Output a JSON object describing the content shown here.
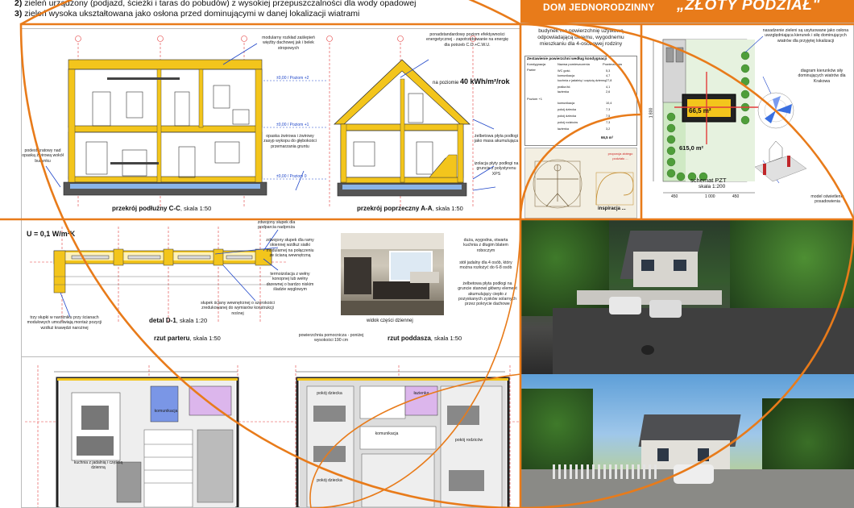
{
  "header": {
    "req_2_num": "2)",
    "req_2_text": "zieleń urządzony (podjazd, ścieżki i taras do pobudów) z wysokiej przepuszczalności dla wody opadowej",
    "req_3_num": "3)",
    "req_3_text": "zieleń wysoka ukształtowana jako osłona przed dominującymi w danej lokalizacji wiatrami",
    "subtitle": "DOM JEDNORODZINNY",
    "title": "„ZŁOTY PODZIAŁ\""
  },
  "sections": {
    "cc_label": "przekrój podłużny C-C",
    "cc_scale": ", skala 1:50",
    "aa_label": "przekrój poprzeczny A-A",
    "aa_scale": ", skala 1:50",
    "d1_label": "detal D-1",
    "d1_scale": ", skala 1:20",
    "u_value": "U = 0,1 W/m²K",
    "parter_label": "rzut parteru",
    "parter_scale": ", skala 1:50",
    "poddasze_label": "rzut poddasza",
    "poddasze_scale": ", skala 1:50",
    "render_caption": "widok części dziennej",
    "energy_value": "40 kWh/m²/rok",
    "energy_prefix": "na poziomie"
  },
  "notes": {
    "n1": "modularny rozkład zaślepień więźby dachowej jak i belek stropowych",
    "n2": "ponadstandardowy poziom efektywności energetycznej - zapotrzebowanie na energię dla potrzeb C.O.+C.W.U.",
    "n3": "podest kratowy nad opaską żwirową wokół budynku",
    "n4": "opaska żwirowa i żwirowy zasyp wykopu do głębokości przemarzania gruntu",
    "n5": "żelbetowa płyta podłogi jako masa akumulująca",
    "n6": "izolacja płyty podłogi na gruncie z polystyrenu XPS",
    "n7": "zdwojony słupek dla podparcia nadproża",
    "n8": "zdwojony słupek dla ramy okiennej wzdłuż siatki modularnej na połączeniu ze ścianą wewnętrzną",
    "n9": "termoizolacja z wełny konopnej lub wełny drzewnej o bardzo niskim śladzie węglowym",
    "n10": "słupek ściany wewnętrznej o szerokości zredukowanej do wymiarów konstrukcji nośnej",
    "n11": "trzy słupki w narożniku przy ścianach modułowych umożliwiają montaż pozycji wzdłuż krawędzi narożnej",
    "n12": "duża, wygodna, otwarta kuchnia z długim blatem roboczym",
    "n13": "stół jadalny dla 4 osób, który można rozłożyć do 6-8 osób",
    "n14": "żelbetowa płyta podłogi na gruncie stanowi główny element akumulujący ciepło z pozyskanych zysków solarnych przez pokrycie dachowe",
    "n15": "powierzchnia pomocnicza - poniżej wysokości 190 cm",
    "n16": "nasadzenie zieleni są usytuowane jako osłona uwzględniająca kierunek i siłę dominujących wiatrów dla przyjętej lokalizacji",
    "n17": "diagram kierunków siły dominujących wiatrów dla Krakowa",
    "n18": "model oświetlenia posadowienia",
    "n19": "kuchnia z jadalnią i częścią dzienną",
    "n20": "komunikacja",
    "n21": "pokój dziecka",
    "n22": "pokój dziecka",
    "n23": "komunikacja",
    "n24": "pokój rodziców",
    "n25": "łazienka"
  },
  "info": {
    "desc": "budynek ma powierzchnię użytkową odpowiadającą duremu, wygodnemu mieszkaniu dla 4-osobowej rodziny",
    "table_title": "Zestawienie powierzchni według kondygnacji",
    "col1": "Kondygnacja",
    "col2": "Nazwa pomieszczenia",
    "col3": "Powierzchnia",
    "floor0": "Parter",
    "floor1": "Poziom +1",
    "rows": [
      {
        "name": "WC gość.",
        "area": "5,3"
      },
      {
        "name": "komunikacja",
        "area": "4,7"
      },
      {
        "name": "kuchnia z jadalnią i częścią dzienną",
        "area": "27,8"
      },
      {
        "name": "pralka itd.",
        "area": "4,1"
      },
      {
        "name": "łazienka",
        "area": "2,6"
      },
      {
        "name": "komunikacja",
        "area": "10,4"
      },
      {
        "name": "pokój dziecka",
        "area": "7,3"
      },
      {
        "name": "pokój dziecka",
        "area": "7,5"
      },
      {
        "name": "pokój rodziców",
        "area": "7,3"
      },
      {
        "name": "łazienka",
        "area": "3,2"
      }
    ],
    "total": "66,5 m²",
    "inspiration": "inspiracja ...",
    "golden_note": "proporcja złotego podziału ..."
  },
  "site": {
    "area_center": "66,5 m²",
    "area_plot": "615,0 m²",
    "schema_label": "schemat PZT",
    "schema_scale": "skala 1:200",
    "dim_450": "450",
    "dim_1800": "1 800",
    "dim_1000": "1 000",
    "dim_450b": "450"
  },
  "colors": {
    "accent": "#e87b1a",
    "annot": "#1f46c9",
    "wood": "#f3c51c",
    "grid": "#e33b3b"
  }
}
